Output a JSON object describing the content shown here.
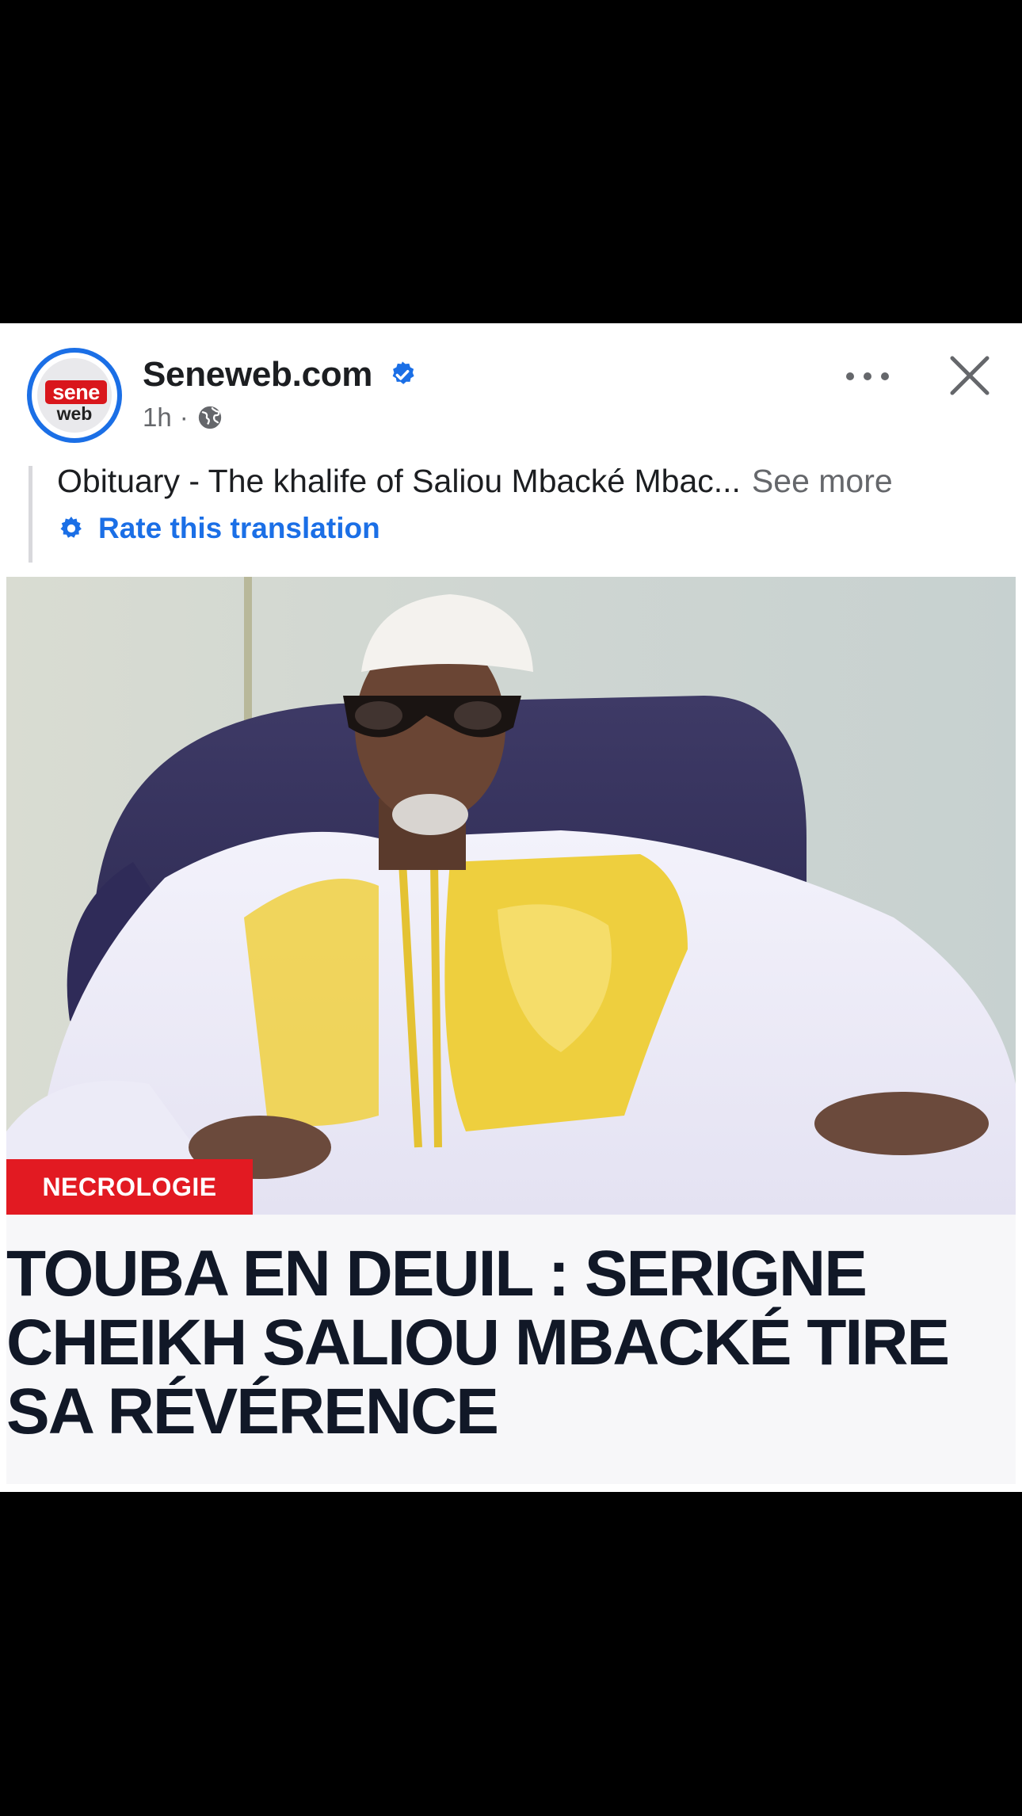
{
  "post": {
    "page_name": "Seneweb.com",
    "logo": {
      "top": "sene",
      "bottom": "web"
    },
    "time": "1h",
    "separator": "·",
    "text": "Obituary - The khalife of Saliou Mbacké Mbac...",
    "see_more": "See more",
    "rate_translation": "Rate this translation"
  },
  "image": {
    "badge": "NECROLOGIE",
    "headline": "TOUBA EN DEUIL : SERIGNE CHEIKH SALIOU MBACKÉ TIRE SA RÉVÉRENCE"
  },
  "colors": {
    "accent": "#1b6fe6",
    "badge_red": "#e21a22",
    "headline": "#111827"
  },
  "icons": {
    "verified": "verified-badge-icon",
    "privacy": "globe-icon",
    "more": "more-options-icon",
    "close": "close-icon",
    "rate": "gear-icon"
  }
}
